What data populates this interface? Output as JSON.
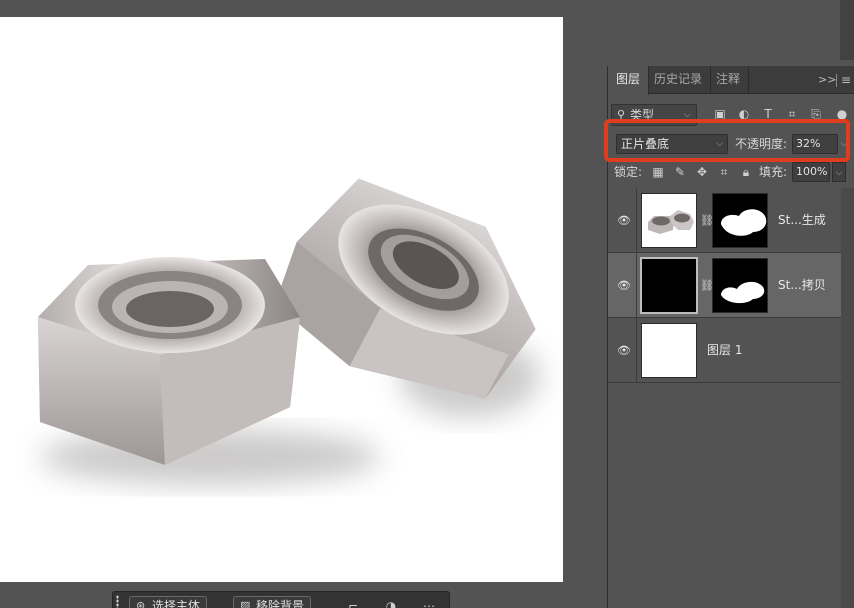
{
  "canvas": {
    "description_icon": "hex-nuts-image"
  },
  "layers_panel": {
    "tabs": [
      {
        "label": "图层",
        "active": true
      },
      {
        "label": "历史记录",
        "active": false
      },
      {
        "label": "注释",
        "active": false
      }
    ],
    "collapse_icon": "double-chevron-right-icon",
    "menu_icon": "panel-menu-icon",
    "filter": {
      "label": "类型",
      "icons": [
        "image-filter-icon",
        "adjustment-filter-icon",
        "type-filter-icon",
        "shape-filter-icon",
        "smart-object-filter-icon"
      ]
    },
    "blend_mode": "正片叠底",
    "opacity_label": "不透明度:",
    "opacity_value": "32%",
    "lock_label": "锁定:",
    "lock_icons": [
      "lock-transparency-icon",
      "lock-pixels-icon",
      "lock-position-icon",
      "artboard-lock-icon",
      "lock-all-icon"
    ],
    "fill_label": "填充:",
    "fill_value": "100%",
    "layers": [
      {
        "name": "St...生成",
        "thumb": "nuts-thumbnail",
        "mask": "mask-thumbnail",
        "visible": true,
        "selected": false
      },
      {
        "name": "St...拷贝",
        "thumb": "black-fill-thumbnail",
        "mask": "mask-thumbnail",
        "visible": true,
        "selected": true
      },
      {
        "name": "图层 1",
        "thumb": "white-fill-thumbnail",
        "visible": true,
        "selected": false
      }
    ],
    "highlight_color": "#e03c1f"
  },
  "taskbar": {
    "select_subject": "选择主体",
    "remove_background": "移除背景"
  }
}
